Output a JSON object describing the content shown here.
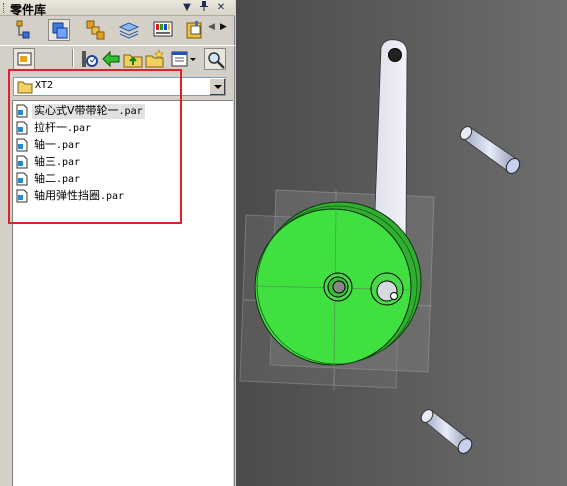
{
  "panel": {
    "title": "零件库",
    "title_buttons": [
      "▼",
      "ᵖ",
      "✕"
    ]
  },
  "toolbar1": {
    "icons": [
      "tree-icon",
      "parts-icon",
      "assembly-icon",
      "layers-icon",
      "palette-icon",
      "library-icon"
    ],
    "scroll_left": "◀",
    "scroll_right": "▶"
  },
  "toolbar2": {
    "icons": [
      "view-icon",
      "folder-up-icon",
      "back-icon",
      "up-folder-icon",
      "new-folder-icon",
      "views-menu-icon",
      "search-icon"
    ]
  },
  "folder": {
    "current": "XT2"
  },
  "files": [
    {
      "name": "实心式V带带轮一",
      "ext": ".par",
      "selected": true
    },
    {
      "name": "拉杆一",
      "ext": ".par",
      "selected": false
    },
    {
      "name": "轴一",
      "ext": ".par",
      "selected": false
    },
    {
      "name": "轴三",
      "ext": ".par",
      "selected": false
    },
    {
      "name": "轴二",
      "ext": ".par",
      "selected": false
    },
    {
      "name": "轴用弹性挡圈",
      "ext": ".par",
      "selected": false
    }
  ],
  "colors": {
    "highlight_box": "#e0202a",
    "pulley": "#3fe03f",
    "viewport_bg": "#555555"
  }
}
